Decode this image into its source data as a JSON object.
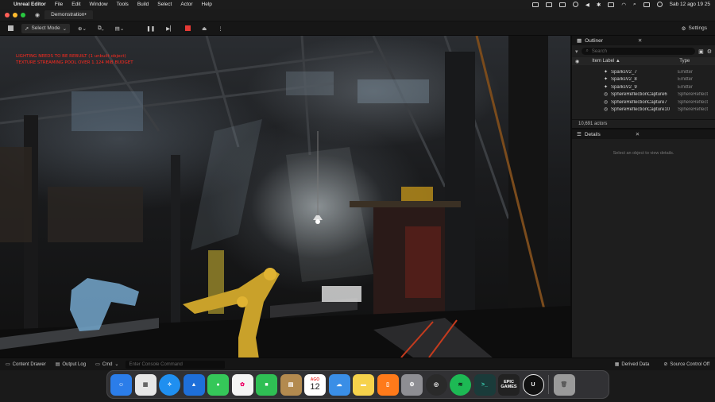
{
  "menubar": {
    "app_name": "Unreal Editor",
    "items": [
      "File",
      "Edit",
      "Window",
      "Tools",
      "Build",
      "Select",
      "Actor",
      "Help"
    ],
    "clock": "Sab 12 ago  19 25"
  },
  "titlebar": {
    "tab": "Demonstration•"
  },
  "toolbar": {
    "mode": "Select Mode",
    "settings": "Settings"
  },
  "viewport": {
    "warning_1": "LIGHTING NEEDS TO BE REBUILT (1 unbuilt object)",
    "warning_2": "TEXTURE STREAMING POOL OVER 1.124 MiB BUDGET"
  },
  "outliner": {
    "tab": "Outliner",
    "search_placeholder": "Search",
    "col_label": "Item Label ▲",
    "col_type": "Type",
    "rows": [
      {
        "label": "SparksV2_7",
        "type": "Emitter"
      },
      {
        "label": "SparksV2_8",
        "type": "Emitter"
      },
      {
        "label": "SparksV2_9",
        "type": "Emitter"
      },
      {
        "label": "SphereReflectionCapture6",
        "type": "SphereReflect"
      },
      {
        "label": "SphereReflectionCapture7",
        "type": "SphereReflect"
      },
      {
        "label": "SphereReflectionCapture10",
        "type": "SphereReflect"
      }
    ],
    "count": "10,691 actors"
  },
  "details": {
    "tab": "Details",
    "hint": "Select an object to view details."
  },
  "bottombar": {
    "content_drawer": "Content Drawer",
    "output_log": "Output Log",
    "cmd": "Cmd",
    "console_placeholder": "Enter Console Command",
    "derived_data": "Derived Data",
    "source_control": "Source Control Off"
  },
  "dock": {
    "calendar_month": "AGO",
    "calendar_day": "12",
    "epic_label": "EPIC GAMES",
    "apps": [
      {
        "name": "finder-icon",
        "color": "#2b7de9"
      },
      {
        "name": "launchpad-icon",
        "color": "#e7e7e7"
      },
      {
        "name": "safari-icon",
        "color": "#1f8ff0"
      },
      {
        "name": "testflight-icon",
        "color": "#1e6fd9"
      },
      {
        "name": "messages-icon",
        "color": "#35c759"
      },
      {
        "name": "photos-icon",
        "color": "#f4f4f4"
      },
      {
        "name": "facetime-icon",
        "color": "#2fbf54"
      },
      {
        "name": "notes-brown-icon",
        "color": "#b38a4f"
      },
      {
        "name": "calendar-icon",
        "color": "#ffffff"
      },
      {
        "name": "weather-icon",
        "color": "#3a8ee6"
      },
      {
        "name": "notes-icon",
        "color": "#f6d24b"
      },
      {
        "name": "books-icon",
        "color": "#ff7a1a"
      },
      {
        "name": "settings-icon",
        "color": "#8e8e93"
      },
      {
        "name": "ue-launcher-icon",
        "color": "#2a2a2a"
      },
      {
        "name": "spotify-icon",
        "color": "#1db954"
      },
      {
        "name": "terminal-icon",
        "color": "#1a3b3a"
      },
      {
        "name": "epic-games-icon",
        "color": "#222222"
      },
      {
        "name": "unreal-icon",
        "color": "#111111"
      },
      {
        "name": "trash-icon",
        "color": "#9a9a9a"
      }
    ]
  }
}
